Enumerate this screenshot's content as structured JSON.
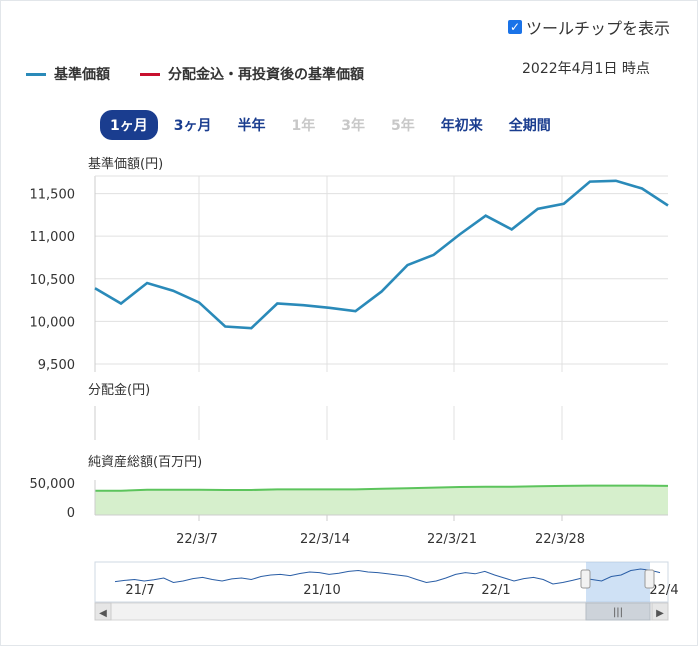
{
  "ui": {
    "tooltip_label": "ツールチップを表示",
    "legend": [
      {
        "label": "基準価額",
        "color": "#2a8ab9"
      },
      {
        "label": "分配金込・再投資後の基準価額",
        "color": "#c8102e"
      }
    ],
    "as_of": "2022年4月1日 時点",
    "periods": [
      {
        "label": "1ヶ月",
        "state": "active"
      },
      {
        "label": "3ヶ月",
        "state": "enabled"
      },
      {
        "label": "半年",
        "state": "enabled"
      },
      {
        "label": "1年",
        "state": "disabled"
      },
      {
        "label": "3年",
        "state": "disabled"
      },
      {
        "label": "5年",
        "state": "disabled"
      },
      {
        "label": "年初来",
        "state": "enabled"
      },
      {
        "label": "全期間",
        "state": "enabled"
      }
    ]
  },
  "chart_data": [
    {
      "type": "line",
      "ylabel": "基準価額(円)",
      "ylim": [
        9500,
        11800
      ],
      "yticks": [
        "11,500",
        "11,000",
        "10,500",
        "10,000",
        "9,500"
      ],
      "ytick_values": [
        11500,
        11000,
        10500,
        10000,
        9500
      ],
      "x": [
        "22/3/2",
        "22/3/3",
        "22/3/4",
        "22/3/7",
        "22/3/8",
        "22/3/9",
        "22/3/10",
        "22/3/11",
        "22/3/14",
        "22/3/15",
        "22/3/16",
        "22/3/17",
        "22/3/18",
        "22/3/22",
        "22/3/23",
        "22/3/24",
        "22/3/25",
        "22/3/28",
        "22/3/29",
        "22/3/30",
        "22/3/31",
        "22/4/1"
      ],
      "series": [
        {
          "name": "基準価額",
          "color": "#2a8ab9",
          "values": [
            10390,
            10210,
            10450,
            10360,
            10220,
            9940,
            9920,
            10210,
            10190,
            10160,
            10120,
            10350,
            10660,
            10780,
            11020,
            11240,
            11080,
            11320,
            11380,
            11640,
            11650,
            11560,
            11360
          ]
        }
      ]
    },
    {
      "type": "bar",
      "ylabel": "分配金(円)",
      "values": []
    },
    {
      "type": "area",
      "ylabel": "純資産総額(百万円)",
      "yticks": [
        "50,000",
        "0"
      ],
      "ytick_values": [
        50000,
        0
      ],
      "color": "#5cc45c",
      "fill": "#d6efcc",
      "values": [
        38000,
        38000,
        40000,
        40000,
        40000,
        39500,
        39500,
        40500,
        40500,
        40500,
        40500,
        41500,
        42500,
        43500,
        44500,
        45000,
        45000,
        46000,
        46500,
        47000,
        47000,
        47000,
        46500
      ],
      "xticks": [
        "22/3/7",
        "22/3/14",
        "22/3/21",
        "22/3/28"
      ]
    },
    {
      "type": "area",
      "xticks": [
        "21/7",
        "21/10",
        "22/1",
        "22/4"
      ],
      "color": "#2a5ea6",
      "values": [
        0.48,
        0.52,
        0.55,
        0.5,
        0.54,
        0.6,
        0.45,
        0.5,
        0.58,
        0.62,
        0.55,
        0.5,
        0.57,
        0.6,
        0.55,
        0.65,
        0.7,
        0.72,
        0.68,
        0.75,
        0.8,
        0.78,
        0.72,
        0.76,
        0.82,
        0.85,
        0.8,
        0.78,
        0.74,
        0.7,
        0.66,
        0.55,
        0.45,
        0.5,
        0.6,
        0.72,
        0.78,
        0.74,
        0.82,
        0.7,
        0.6,
        0.5,
        0.58,
        0.62,
        0.55,
        0.4,
        0.45,
        0.52,
        0.6,
        0.55,
        0.5,
        0.65,
        0.7,
        0.85,
        0.9,
        0.86,
        0.78
      ]
    }
  ]
}
